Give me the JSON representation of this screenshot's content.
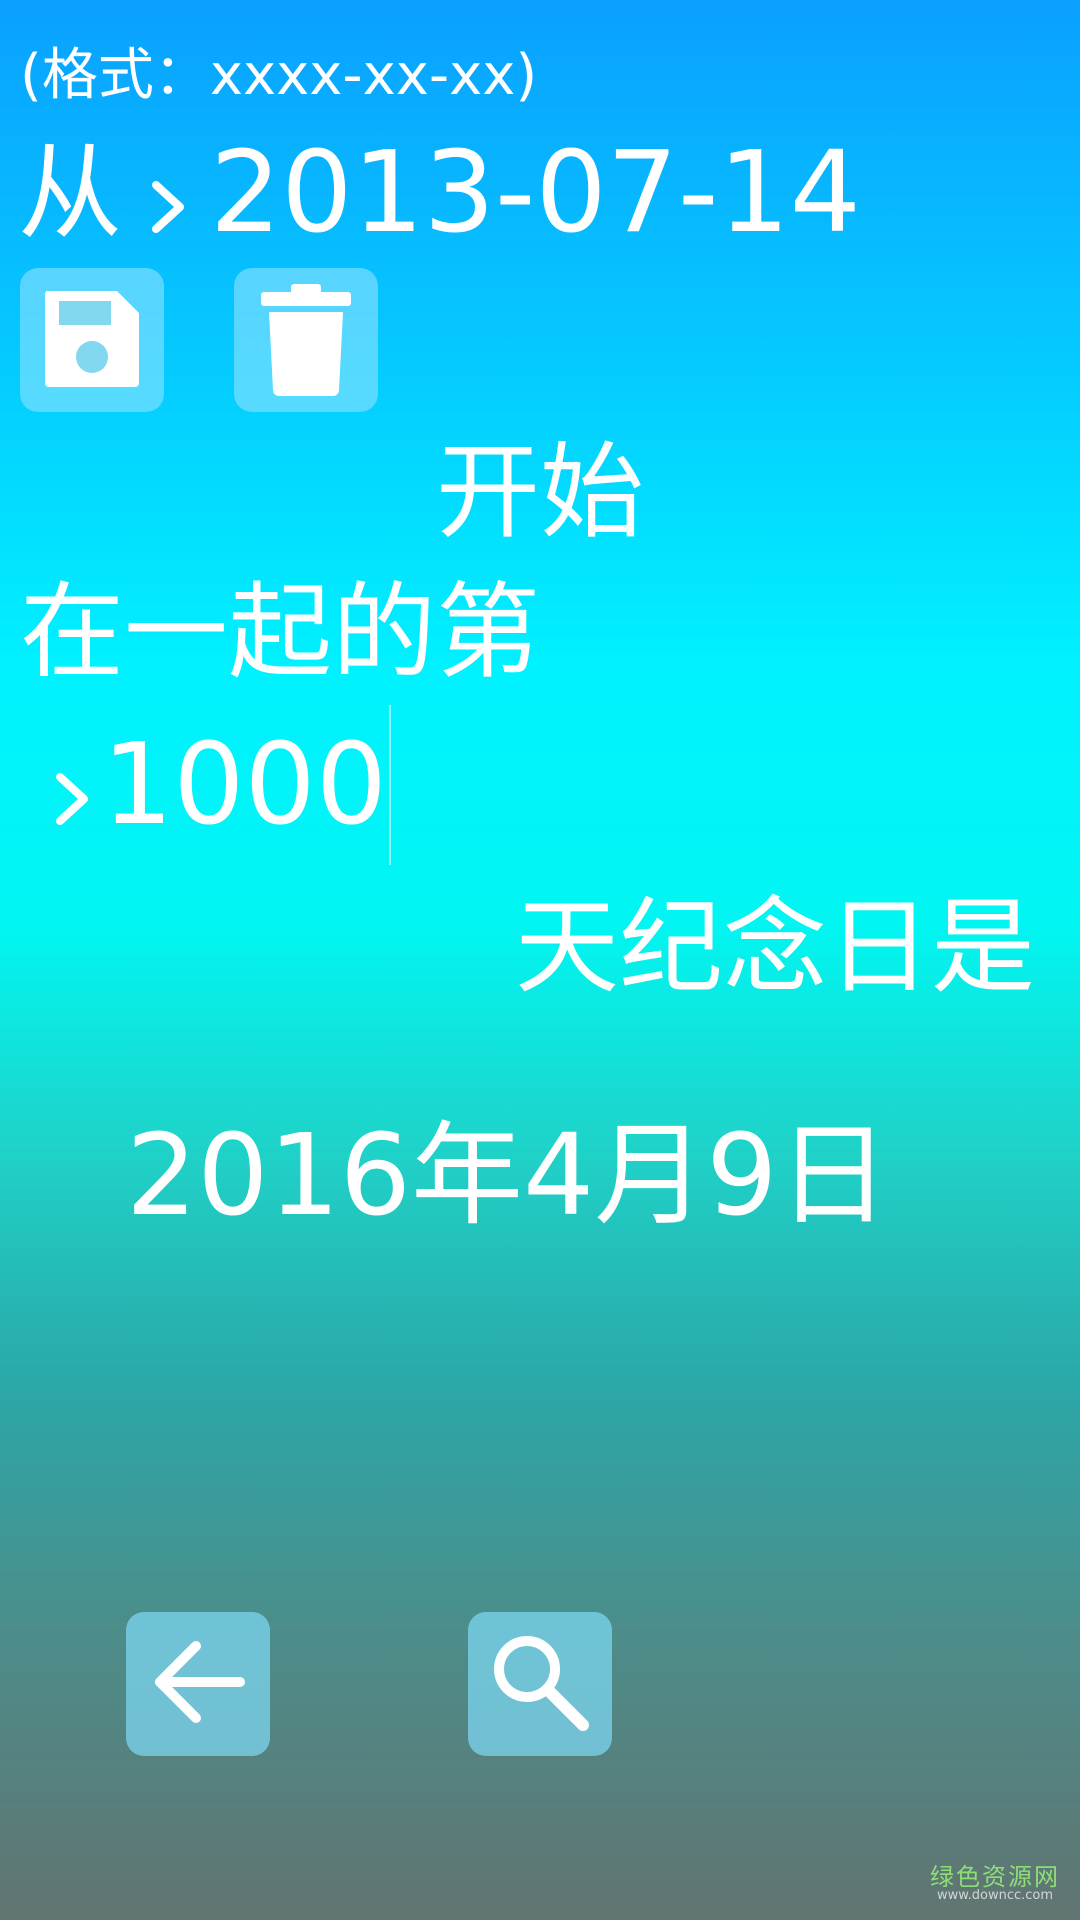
{
  "format_hint": "(格式：xxxx-xx-xx)",
  "from_label": "从",
  "start_date": "2013-07-14",
  "start_label": "开始",
  "together_label": "在一起的第",
  "days_value": "1000",
  "anniversary_label": "天纪念日是",
  "result_date": "2016年4月9日",
  "icons": {
    "save": "floppy-disk-icon",
    "delete": "trash-icon",
    "back": "arrow-left-icon",
    "search": "search-icon",
    "chevron": "chevron-right-icon"
  },
  "watermark": {
    "main": "绿色资源网",
    "sub": "www.downcc.com"
  },
  "colors": {
    "button_bg": "#82e1ff",
    "text": "#ffffff"
  }
}
